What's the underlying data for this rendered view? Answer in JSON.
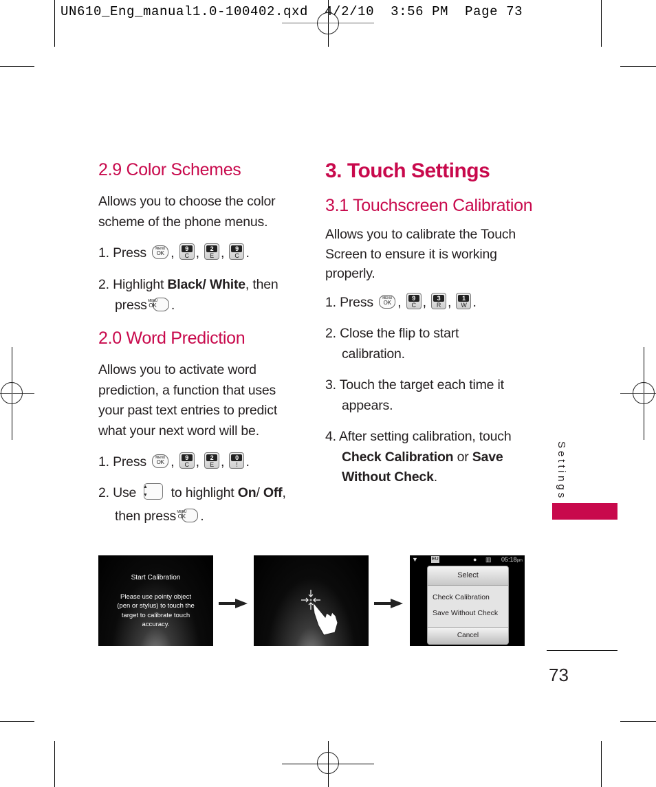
{
  "slug": "UN610_Eng_manual1.0-100402.qxd  4/2/10  3:56 PM  Page 73",
  "left": {
    "color_schemes": {
      "heading": "2.9 Color Schemes",
      "body": "Allows you to choose the color scheme of the phone menus.",
      "step1_prefix": "1. Press",
      "step1_keys": [
        {
          "num": "9",
          "letter": "C"
        },
        {
          "num": "2",
          "letter": "E"
        },
        {
          "num": "9",
          "letter": "C"
        }
      ],
      "step2_prefix": "2. Highlight ",
      "step2_bold": "Black/ White",
      "step2_suffix": ", then press"
    },
    "word_prediction": {
      "heading": "2.0 Word Prediction",
      "body": "Allows you to activate word prediction, a function that uses your past text entries to predict what your next word will be.",
      "step1_prefix": "1. Press",
      "step1_keys": [
        {
          "num": "9",
          "letter": "C"
        },
        {
          "num": "2",
          "letter": "E"
        },
        {
          "num": "0",
          "letter": "!"
        }
      ],
      "step2_prefix": "2. Use",
      "step2_mid": " to highlight ",
      "step2_bold1": "On",
      "step2_slash": "/",
      "step2_bold2": "Off",
      "step2_suffix": ", then press"
    }
  },
  "right": {
    "title": "3. Touch Settings",
    "calibration": {
      "heading": "3.1 Touchscreen Calibration",
      "body": "Allows you to calibrate the Touch Screen to ensure it is working properly.",
      "step1_prefix": "1. Press",
      "step1_keys": [
        {
          "num": "9",
          "letter": "C"
        },
        {
          "num": "3",
          "letter": "R"
        },
        {
          "num": "1",
          "letter": "W"
        }
      ],
      "step2": "2. Close the flip to start calibration.",
      "step3": "3. Touch the target each time it appears.",
      "step4_prefix": "4. After setting calibration, touch ",
      "step4_bold1": "Check Calibration",
      "step4_or": " or ",
      "step4_bold2": "Save Without Check",
      "step4_end": "."
    }
  },
  "ok_key": {
    "menu": "MENU",
    "ok": "OK"
  },
  "screens": {
    "screen1": {
      "title": "Start Calibration",
      "text": "Please use pointy object (pen or stylus) to touch the target to calibrate touch accuracy."
    },
    "screen3": {
      "status_time": "05:18",
      "status_ampm": "pm",
      "status_eu": "EU",
      "dialog_title": "Select",
      "options": [
        "Check Calibration",
        "Save Without Check"
      ],
      "cancel": "Cancel"
    }
  },
  "side_label": "Settings",
  "page_number": "73",
  "accent_color": "#c8094c"
}
